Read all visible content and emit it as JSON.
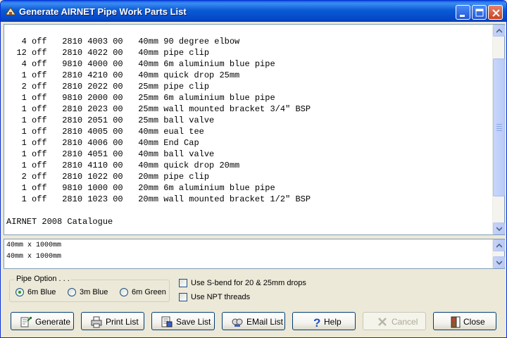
{
  "window": {
    "title": "Generate AIRNET Pipe Work Parts List"
  },
  "titlebar_buttons": [
    "minimize-icon",
    "maximize-icon",
    "close-icon"
  ],
  "parts_list": {
    "lines": [
      "   4 off   2810 4003 00   40mm 90 degree elbow",
      "  12 off   2810 4022 00   40mm pipe clip",
      "   4 off   9810 4000 00   40mm 6m aluminium blue pipe",
      "   1 off   2810 4210 00   40mm quick drop 25mm",
      "   2 off   2810 2022 00   25mm pipe clip",
      "   1 off   9810 2000 00   25mm 6m aluminium blue pipe",
      "   1 off   2810 2023 00   25mm wall mounted bracket 3/4\" BSP",
      "   1 off   2810 2051 00   25mm ball valve",
      "   1 off   2810 4005 00   40mm eual tee",
      "   1 off   2810 4006 00   40mm End Cap",
      "   1 off   2810 4051 00   40mm ball valve",
      "   1 off   2810 4110 00   40mm quick drop 20mm",
      "   2 off   2810 1022 00   20mm pipe clip",
      "   1 off   9810 1000 00   20mm 6m aluminium blue pipe",
      "   1 off   2810 1023 00   20mm wall mounted bracket 1/2\" BSP",
      "",
      "AIRNET 2008 Catalogue"
    ]
  },
  "dimensions_list": {
    "lines": [
      "40mm x 1000mm",
      "40mm x 1000mm"
    ]
  },
  "pipe_option": {
    "legend": "Pipe Option . . .",
    "options": [
      {
        "label": "6m Blue",
        "selected": true
      },
      {
        "label": "3m Blue",
        "selected": false
      },
      {
        "label": "6m Green",
        "selected": false
      }
    ]
  },
  "checkboxes": [
    {
      "label": "Use S-bend for 20 & 25mm drops",
      "checked": false
    },
    {
      "label": "Use NPT threads",
      "checked": false
    }
  ],
  "buttons": [
    {
      "label": "Generate",
      "icon": "generate-icon",
      "enabled": true
    },
    {
      "label": "Print List",
      "icon": "printer-icon",
      "enabled": true
    },
    {
      "label": "Save List",
      "icon": "save-icon",
      "enabled": true
    },
    {
      "label": "EMail List",
      "icon": "email-icon",
      "enabled": true
    },
    {
      "label": "Help",
      "icon": "help-icon",
      "enabled": true
    },
    {
      "label": "Cancel",
      "icon": "cancel-icon",
      "enabled": false
    },
    {
      "label": "Close",
      "icon": "exit-icon",
      "enabled": true
    }
  ],
  "colors": {
    "titlebar": "#0a5bd4",
    "window_bg": "#ece9d8",
    "text_bg": "#ffffff",
    "radio_selected": "#21a121"
  }
}
